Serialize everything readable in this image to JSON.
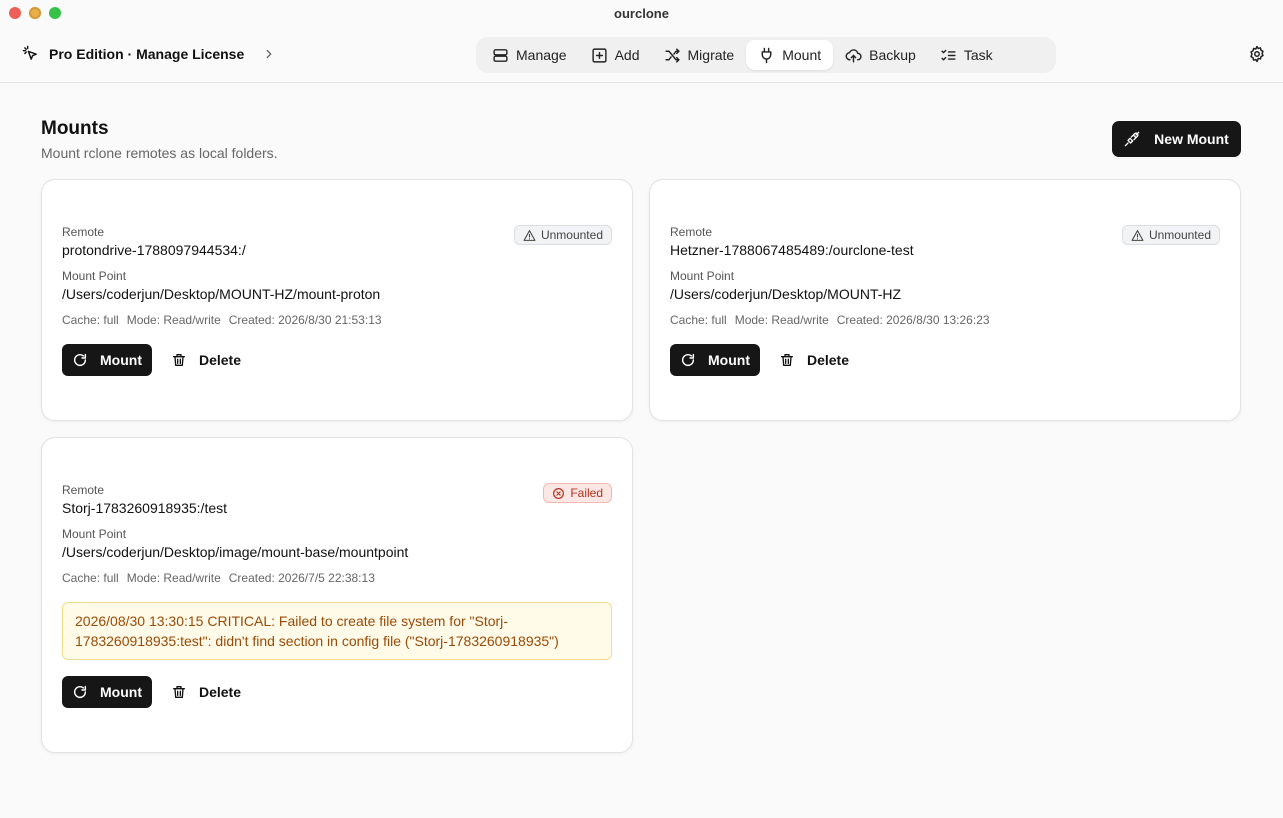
{
  "window": {
    "title": "ourclone"
  },
  "header": {
    "edition": "Pro Edition · Manage License",
    "tabs": [
      {
        "label": "Manage",
        "icon": "server-icon",
        "active": false
      },
      {
        "label": "Add",
        "icon": "plus-square-icon",
        "active": false
      },
      {
        "label": "Migrate",
        "icon": "shuffle-icon",
        "active": false
      },
      {
        "label": "Mount",
        "icon": "plug-icon",
        "active": true
      },
      {
        "label": "Backup",
        "icon": "cloud-upload-icon",
        "active": false
      },
      {
        "label": "Task",
        "icon": "list-checks-icon",
        "active": false
      }
    ]
  },
  "page": {
    "title": "Mounts",
    "subtitle": "Mount rclone remotes as local folders.",
    "new_mount_label": "New Mount"
  },
  "labels": {
    "remote": "Remote",
    "mount_point": "Mount Point",
    "mount_button": "Mount",
    "delete_button": "Delete"
  },
  "mounts": [
    {
      "remote": "protondrive-1788097944534:/",
      "mount_point": "/Users/coderjun/Desktop/MOUNT-HZ/mount-proton",
      "cache": "Cache: full",
      "mode": "Mode: Read/write",
      "created": "Created: 2026/8/30 21:53:13",
      "status": "Unmounted"
    },
    {
      "remote": "Hetzner-1788067485489:/ourclone-test",
      "mount_point": "/Users/coderjun/Desktop/MOUNT-HZ",
      "cache": "Cache: full",
      "mode": "Mode: Read/write",
      "created": "Created: 2026/8/30 13:26:23",
      "status": "Unmounted"
    },
    {
      "remote": "Storj-1783260918935:/test",
      "mount_point": "/Users/coderjun/Desktop/image/mount-base/mountpoint",
      "cache": "Cache: full",
      "mode": "Mode: Read/write",
      "created": "Created: 2026/7/5 22:38:13",
      "status": "Failed",
      "error": "2026/08/30 13:30:15 CRITICAL: Failed to create file system for \"Storj-1783260918935:test\": didn't find section in config file (\"Storj-1783260918935\")"
    }
  ]
}
